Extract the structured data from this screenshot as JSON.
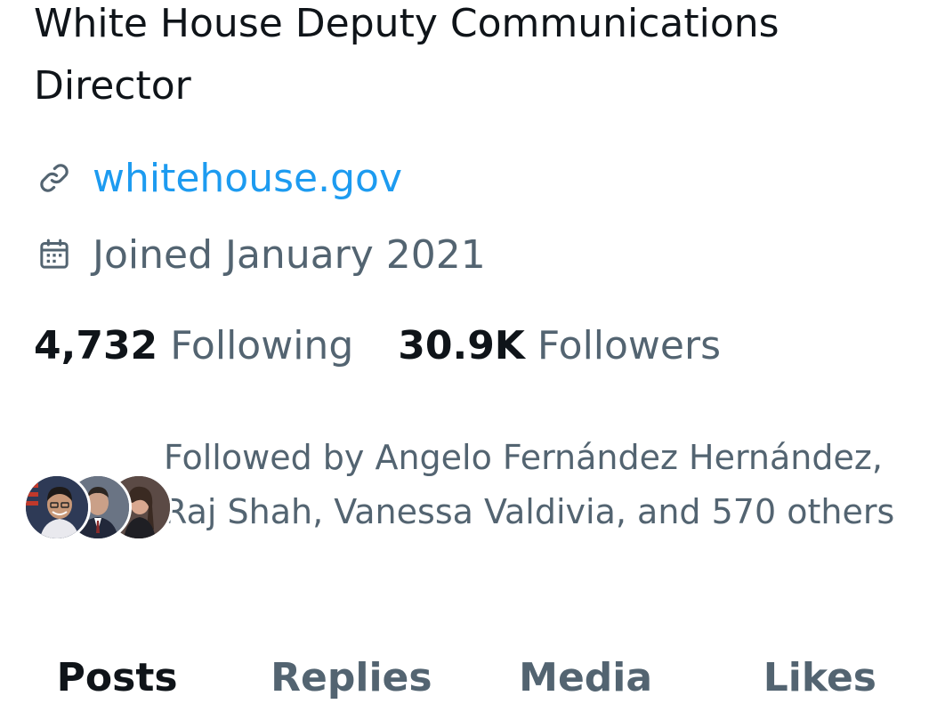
{
  "profile": {
    "bio": "White House Deputy Communications Director",
    "website": {
      "icon": "link-icon",
      "text": "whitehouse.gov"
    },
    "joined": {
      "icon": "calendar-icon",
      "text": "Joined January 2021"
    }
  },
  "stats": {
    "following_count": "4,732",
    "following_label": "Following",
    "followers_count": "30.9K",
    "followers_label": "Followers"
  },
  "followed_by": {
    "text": "Followed by Angelo Fernández Hernández, Raj Shah, Vanessa Valdivia, and 570 others"
  },
  "tabs": [
    {
      "label": "Posts",
      "active": true
    },
    {
      "label": "Replies",
      "active": false
    },
    {
      "label": "Media",
      "active": false
    },
    {
      "label": "Likes",
      "active": false
    }
  ],
  "colors": {
    "text_primary": "#0f1419",
    "text_secondary": "#536471",
    "link": "#1d9bf0",
    "background": "#ffffff"
  }
}
